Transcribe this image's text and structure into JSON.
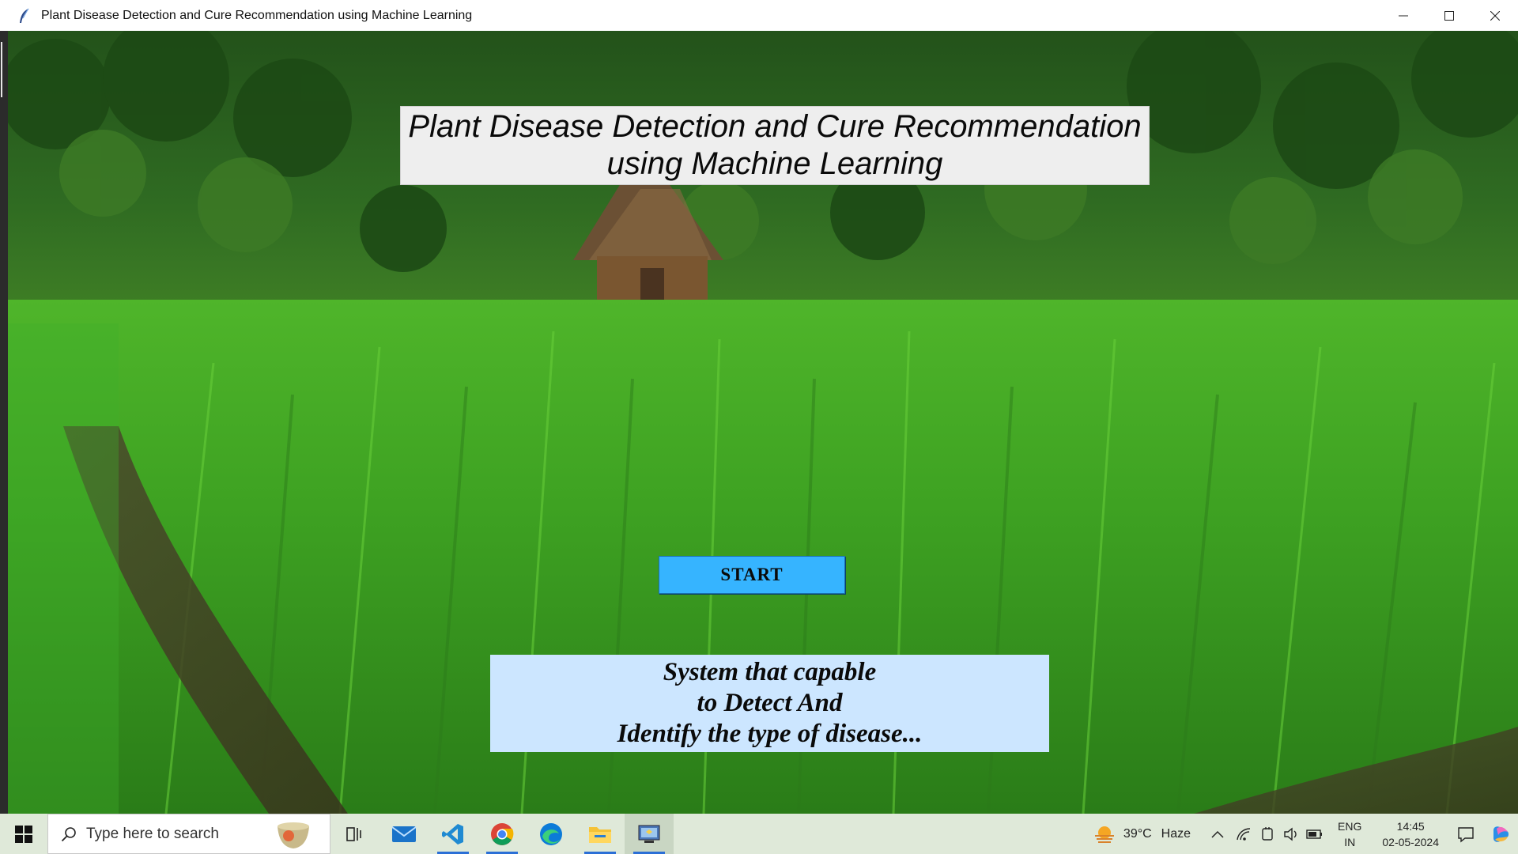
{
  "window": {
    "title": "Plant Disease Detection and Cure Recommendation using Machine Learning",
    "controls": [
      "minimize-icon",
      "maximize-icon",
      "close-icon"
    ]
  },
  "app": {
    "heading": "Plant Disease Detection and Cure Recommendation\nusing Machine Learning",
    "start_label": "START",
    "description": "System that capable\nto Detect And\nIdentify the type of disease..."
  },
  "taskbar": {
    "search_placeholder": "Type here to search",
    "apps": [
      "task-view-icon",
      "mail-icon",
      "vscode-icon",
      "chrome-icon",
      "edge-icon",
      "file-explorer-icon",
      "python-app-icon"
    ],
    "weather_temp": "39°C",
    "weather_text": "Haze",
    "lang_top": "ENG",
    "lang_bottom": "IN",
    "time": "14:45",
    "date": "02-05-2024"
  },
  "colors": {
    "start_button": "#36b4ff",
    "description_box": "#cce6ff",
    "heading_box": "#eeeeee"
  }
}
